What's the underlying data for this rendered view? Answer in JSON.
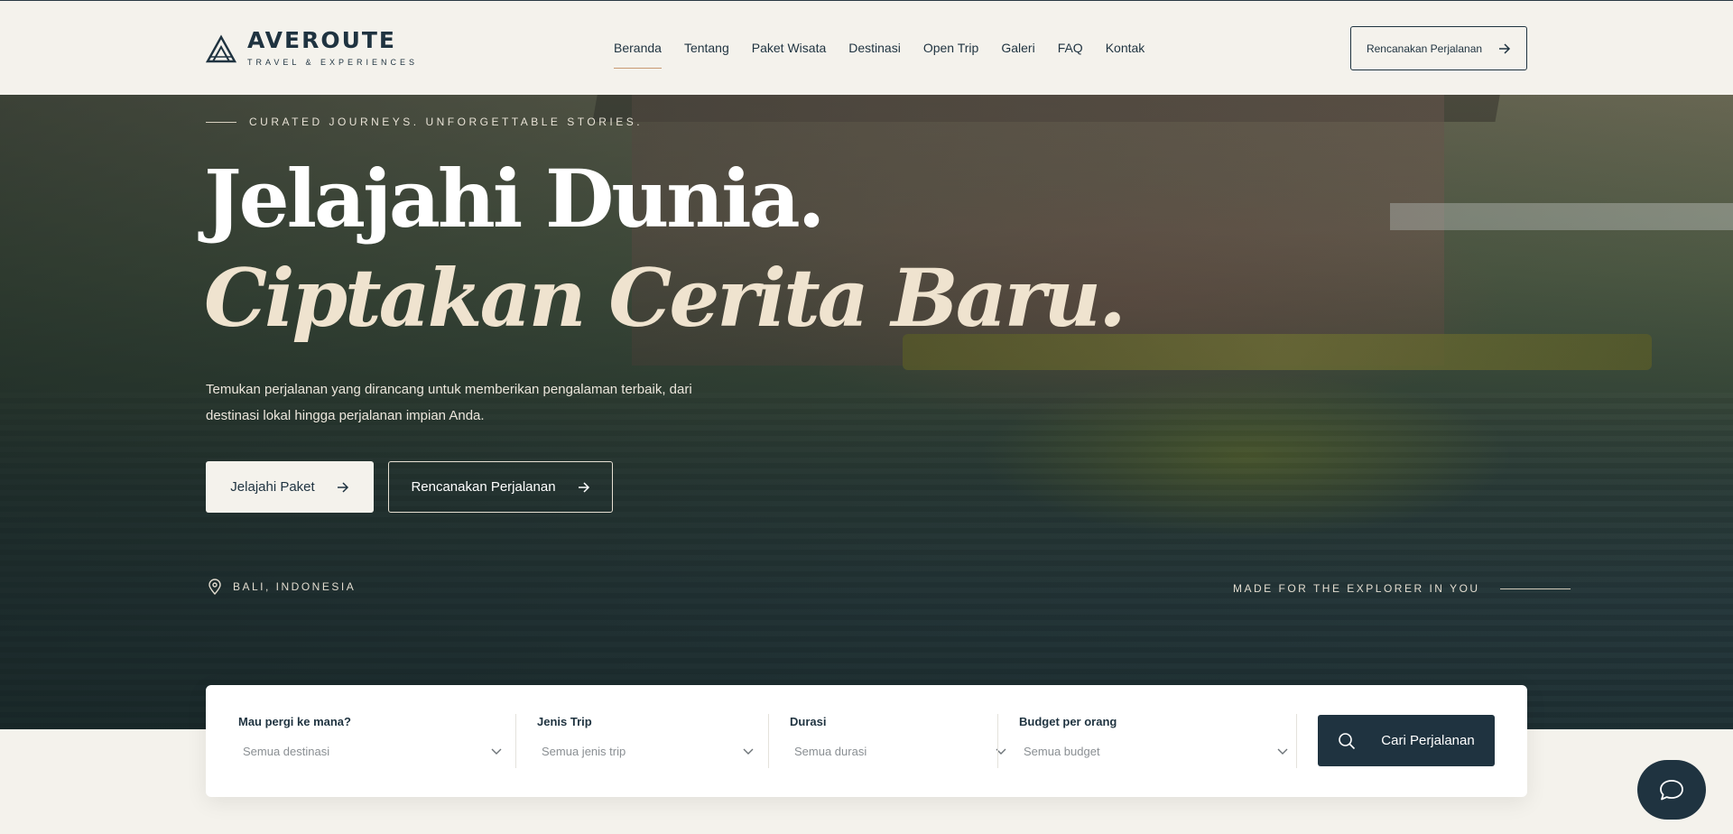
{
  "brand": {
    "name": "AVEROUTE",
    "tagline": "TRAVEL & EXPERIENCES"
  },
  "nav": {
    "items": [
      {
        "label": "Beranda",
        "active": true
      },
      {
        "label": "Tentang"
      },
      {
        "label": "Paket Wisata"
      },
      {
        "label": "Destinasi"
      },
      {
        "label": "Open Trip"
      },
      {
        "label": "Galeri"
      },
      {
        "label": "FAQ"
      },
      {
        "label": "Kontak"
      }
    ],
    "cta_label": "Rencanakan Perjalanan"
  },
  "hero": {
    "eyebrow": "CURATED JOURNEYS. UNFORGETTABLE STORIES.",
    "title_line1": "Jelajahi Dunia.",
    "title_line2": "Ciptakan Cerita Baru.",
    "description": "Temukan perjalanan yang dirancang untuk memberikan pengalaman terbaik, dari destinasi lokal hingga perjalanan impian Anda.",
    "primary_button": "Jelajahi Paket",
    "secondary_button": "Rencanakan Perjalanan",
    "location": "BALI, INDONESIA",
    "tagline": "MADE FOR THE EXPLORER IN YOU"
  },
  "search": {
    "fields": [
      {
        "label": "Mau pergi ke mana?",
        "value": "Semua destinasi"
      },
      {
        "label": "Jenis Trip",
        "value": "Semua jenis trip"
      },
      {
        "label": "Durasi",
        "value": "Semua durasi"
      },
      {
        "label": "Budget per orang",
        "value": "Semua budget"
      }
    ],
    "button_label": "Cari Perjalanan"
  },
  "icons": {
    "logo": "mountain-logo-icon",
    "arrow": "arrow-right-icon",
    "location": "map-pin-icon",
    "chevron": "chevron-down-icon",
    "search": "search-icon",
    "chat": "chat-bubble-icon"
  },
  "colors": {
    "primary": "#1f3340",
    "background": "#f4f2ec",
    "accent": "#c99a72",
    "title_cream": "#efe3cf"
  }
}
